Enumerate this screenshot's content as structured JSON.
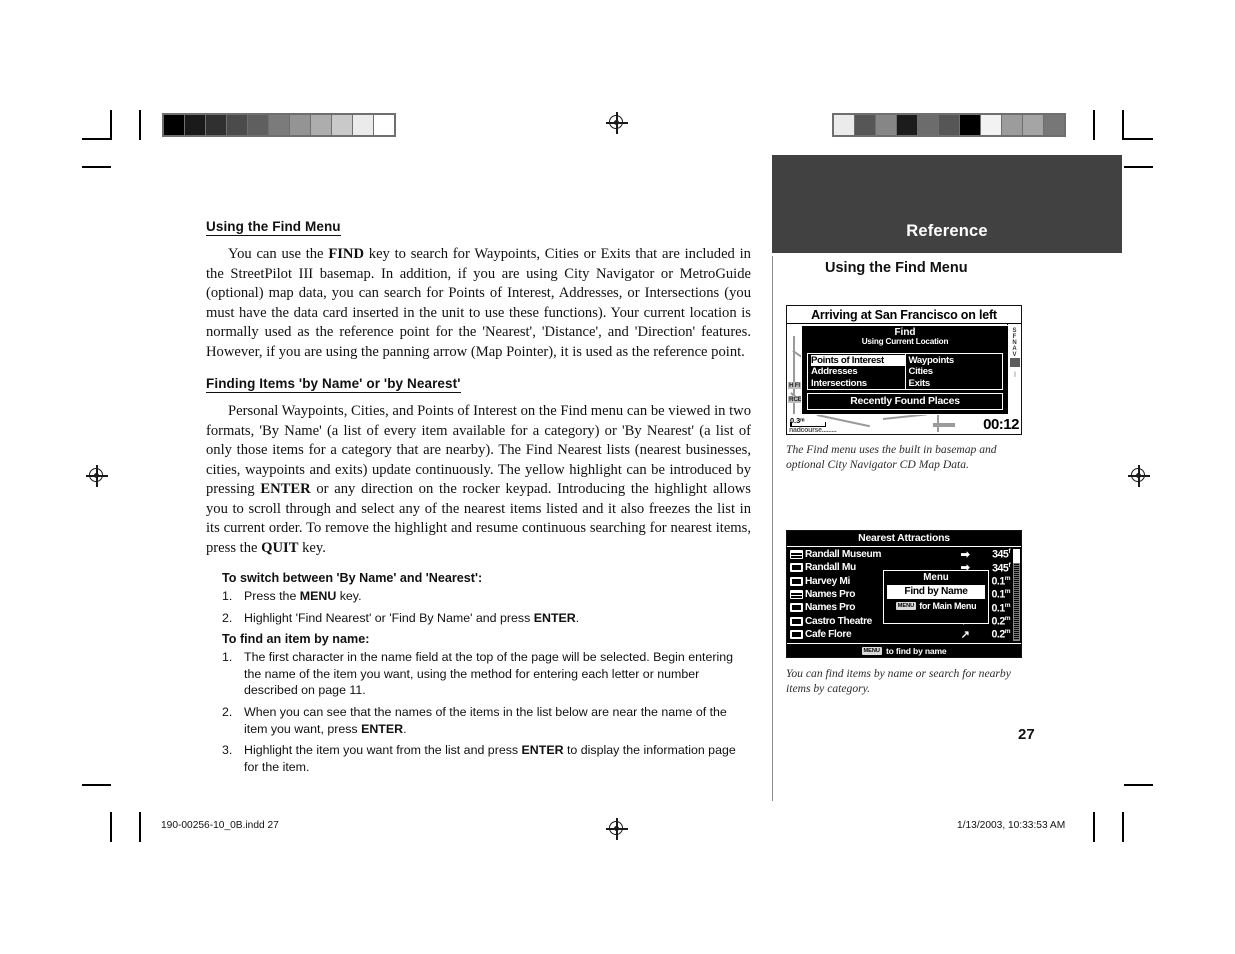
{
  "document": {
    "section_heading": "Using the Find Menu",
    "paragraph_1": "You can use the FIND key to search for Waypoints, Cities or Exits that are included in the StreetPilot III basemap.  In addition, if you are using City Navigator or MetroGuide (optional) map data, you can search for Points of Interest, Addresses, or Intersections (you must have the data card inserted in the unit to use these functions).  Your current location is normally used as the reference point for the 'Nearest', 'Distance', and 'Direction' features.  However, if you are using the panning arrow (Map Pointer), it is used as the reference point.",
    "section_heading_2": "Finding Items 'by Name' or 'by Nearest'",
    "paragraph_2": "Personal Waypoints, Cities, and Points of Interest on the Find menu can be viewed in two formats, 'By Name' (a list of every item available for a category) or 'By Nearest' (a list of only those items for a category that are nearby).  The Find Nearest lists (nearest businesses, cities, waypoints and exits) update continuously.  The yellow highlight can be introduced by pressing ENTER or any direction on the rocker keypad.  Introducing the highlight allows you to scroll through and select any of the nearest items listed and it also freezes the list in its current order.  To remove the highlight and resume continuous searching for nearest items, press the QUIT key.",
    "subhead_1": "To switch between 'By Name' and 'Nearest':",
    "steps_1": [
      "Press the MENU key.",
      "Highlight 'Find Nearest' or 'Find By Name' and press ENTER."
    ],
    "subhead_2": "To find an item by name:",
    "steps_2": [
      "The first character in the name field at the top of the page will be selected.  Begin entering the name of the item you want, using the method for entering each letter or number described on page 11.",
      "When you can see that the names of the items in the list below are near the name of the item you want, press ENTER.",
      "Highlight the item you want from the list and press ENTER to display the information page for the item."
    ]
  },
  "sidebar": {
    "reference_label": "Reference",
    "heading": "Using the Find Menu",
    "caption_1": "The Find menu uses the built in basemap and optional City Navigator CD Map Data.",
    "caption_2": "You can find items by name or search for nearby items by category.",
    "page_number": "27"
  },
  "gps_screen_1": {
    "banner": "Arriving at San Francisco on left",
    "dialog_title": "Find",
    "dialog_subtitle": "Using Current Location",
    "left_column": [
      "Points of Interest",
      "Addresses",
      "Intersections"
    ],
    "right_column": [
      "Waypoints",
      "Cities",
      "Exits"
    ],
    "selected_item": "Points of Interest",
    "recently_found": "Recently Found Places",
    "map_scale": "0.3ᵐ",
    "street_label": "nadcourse.........",
    "side_label_1": "H Fl",
    "side_label_2": "RCE",
    "rail_text": "SF NAV",
    "clock": "00:12"
  },
  "gps_screen_2": {
    "title": "Nearest Attractions",
    "rows": [
      {
        "icon": "museum-icon",
        "name": "Randall Museum",
        "arrow": "➡",
        "distance": "345",
        "unit": "f"
      },
      {
        "icon": "building-icon",
        "name": "Randall Mu",
        "arrow": "➡",
        "distance": "345",
        "unit": "f"
      },
      {
        "icon": "building-icon",
        "name": "Harvey Mi",
        "arrow": "⬅",
        "distance": "0.1",
        "unit": "m"
      },
      {
        "icon": "museum-icon",
        "name": "Names Pro",
        "arrow": "↗",
        "distance": "0.1",
        "unit": "m"
      },
      {
        "icon": "building-icon",
        "name": "Names Pro",
        "arrow": "↗",
        "distance": "0.1",
        "unit": "m"
      },
      {
        "icon": "building-icon",
        "name": "Castro Theatre",
        "arrow": "⬅",
        "distance": "0.2",
        "unit": "m"
      },
      {
        "icon": "building-icon",
        "name": "Cafe Flore",
        "arrow": "↗",
        "distance": "0.2",
        "unit": "m"
      }
    ],
    "menu_title": "Menu",
    "menu_item": "Find by Name",
    "menu_footer_key": "MENU",
    "menu_footer_text": "for Main Menu",
    "footer_key": "MENU",
    "footer_text": "to find by name"
  },
  "footer": {
    "filename": "190-00256-10_0B.indd   27",
    "timestamp": "1/13/2003, 10:33:53 AM"
  },
  "calibration": {
    "left_bar": [
      "#000000",
      "#1a1a1a",
      "#303030",
      "#4b4b4b",
      "#5f5f5f",
      "#7b7b7b",
      "#949494",
      "#adadad",
      "#c9c9c9",
      "#ebebeb",
      "#ffffff"
    ],
    "right_bar": [
      "#ebebeb",
      "#565656",
      "#868686",
      "#1c1c1c",
      "#6c6c6c",
      "#565656",
      "#000000",
      "#f2f2f2",
      "#9c9c9c",
      "#a5a5a5",
      "#777777"
    ]
  }
}
